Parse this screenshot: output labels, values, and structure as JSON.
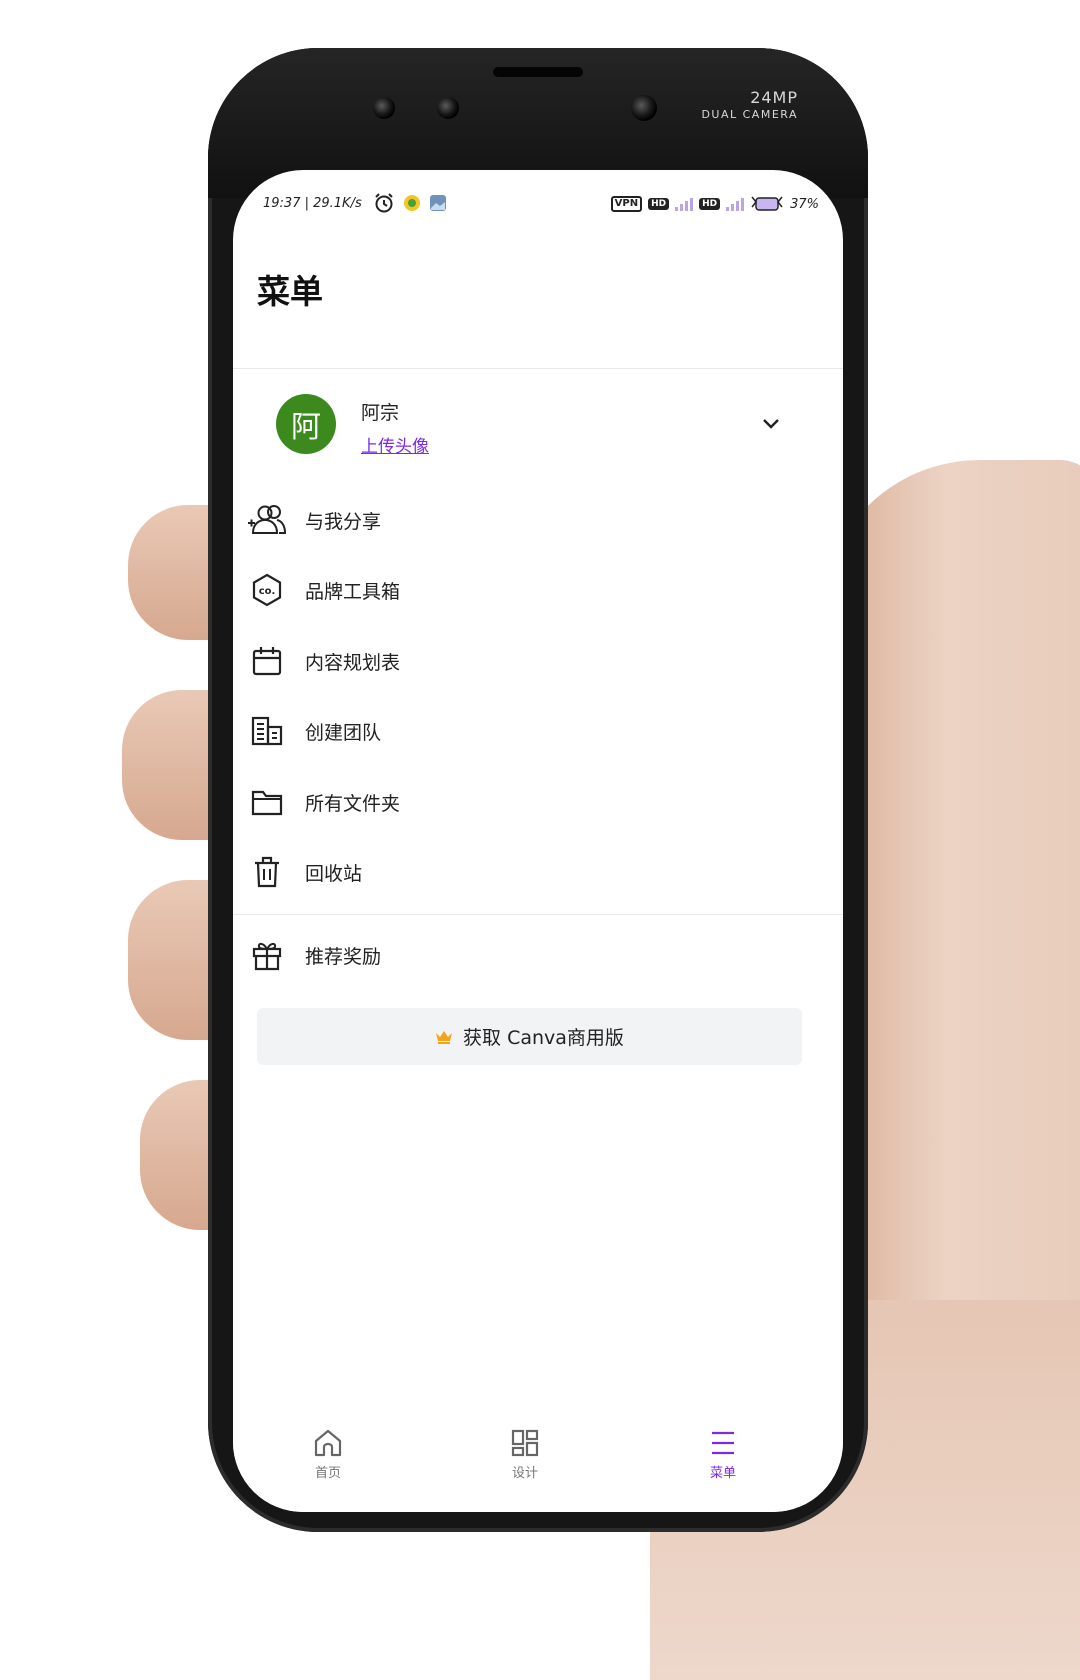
{
  "device": {
    "camera_label_top": "24MP",
    "camera_label_bottom": "DUAL CAMERA"
  },
  "status_bar": {
    "time_speed": "19:37 | 29.1K/s",
    "vpn": "VPN",
    "hd1": "HD",
    "hd2": "HD",
    "battery": "37%"
  },
  "page": {
    "title": "菜单"
  },
  "profile": {
    "avatar_letter": "阿",
    "avatar_color": "#3c8a1e",
    "name": "阿宗",
    "upload_link": "上传头像"
  },
  "menu": {
    "items": [
      {
        "label": "与我分享",
        "icon": "shared-people-icon"
      },
      {
        "label": "品牌工具箱",
        "icon": "brand-kit-icon"
      },
      {
        "label": "内容规划表",
        "icon": "calendar-icon"
      },
      {
        "label": "创建团队",
        "icon": "building-icon"
      },
      {
        "label": "所有文件夹",
        "icon": "folder-icon"
      },
      {
        "label": "回收站",
        "icon": "trash-icon"
      }
    ],
    "referral": {
      "label": "推荐奖励",
      "icon": "gift-icon"
    }
  },
  "upgrade": {
    "label": "获取 Canva商用版",
    "crown_color": "#f2a51a"
  },
  "bottom_nav": {
    "home": "首页",
    "design": "设计",
    "menu": "菜单",
    "active_color": "#7d2ae8"
  }
}
